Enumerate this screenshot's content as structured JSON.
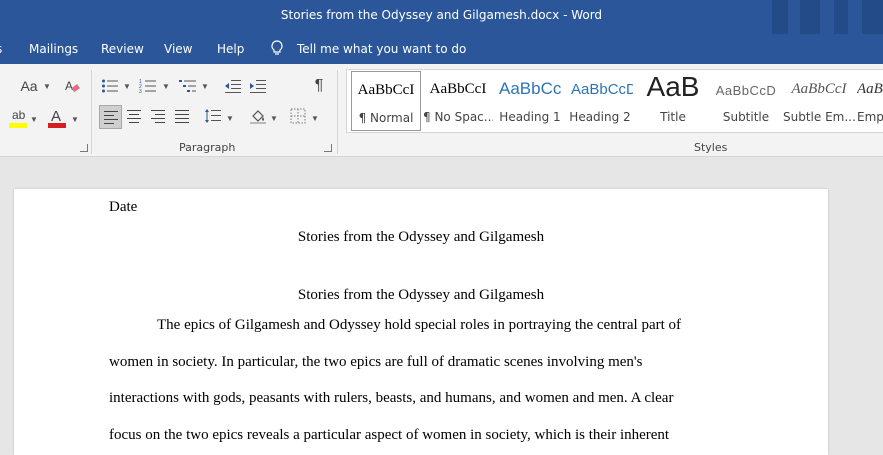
{
  "window": {
    "title": "Stories from the Odyssey and Gilgamesh.docx  -  Word"
  },
  "menu": {
    "items": [
      "Mailings",
      "Review",
      "View",
      "Help"
    ],
    "tell_me": "Tell me what you want to do"
  },
  "ribbon": {
    "font_group": {
      "font_size_glyph": "Aa"
    },
    "paragraph_group": {
      "label": "Paragraph",
      "pilcrow": "¶"
    },
    "styles_group": {
      "label": "Styles",
      "items": [
        {
          "sample": "AaBbCcI",
          "name": "¶ Normal",
          "active": true
        },
        {
          "sample": "AaBbCcI",
          "name": "¶ No Spac..."
        },
        {
          "sample": "AaBbCc",
          "name": "Heading 1"
        },
        {
          "sample": "AaBbCcD",
          "name": "Heading 2"
        },
        {
          "sample": "AaB",
          "name": "Title"
        },
        {
          "sample": "AaBbCcD",
          "name": "Subtitle"
        },
        {
          "sample": "AaBbCcI",
          "name": "Subtle Em..."
        },
        {
          "sample": "AaBb",
          "name": "Emp"
        }
      ]
    }
  },
  "colors": {
    "word_blue": "#2b579a",
    "highlight": "#ffff00",
    "font_red": "#d42020",
    "heading_blue": "#2e74b5"
  },
  "document": {
    "date": "Date",
    "title1": "Stories from the Odyssey and Gilgamesh",
    "title2": "Stories from the Odyssey and Gilgamesh",
    "lines": [
      "The epics of Gilgamesh and Odyssey hold special roles in portraying the central part of",
      "women in society. In particular, the two epics are full of dramatic scenes involving men's",
      "interactions with gods, peasants with rulers, beasts, and humans, and women and men. A clear",
      "focus on the two epics reveals a particular aspect of women in society, which is their inherent"
    ]
  }
}
